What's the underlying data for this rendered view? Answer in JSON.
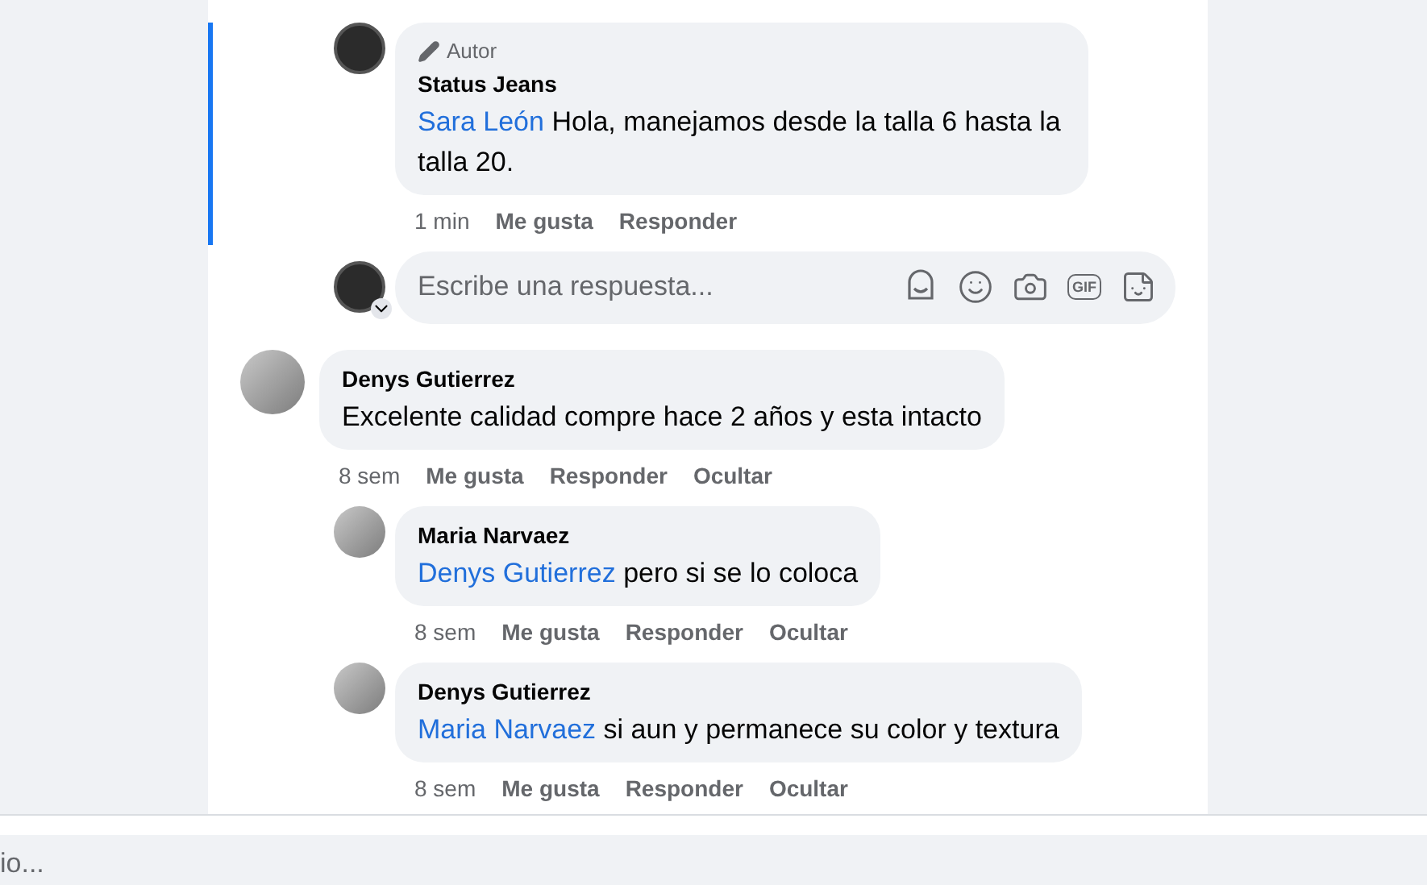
{
  "thread_replies": [
    {
      "badge": "Autor",
      "author": "Status Jeans",
      "mention": "Sara León",
      "text": "Hola, manejamos desde la talla 6 hasta la talla 20.",
      "kind": "logo",
      "time": "1 min",
      "actions": [
        "Me gusta",
        "Responder"
      ]
    }
  ],
  "reply_field": {
    "placeholder": "Escribe una respuesta...",
    "gif_label": "GIF"
  },
  "comments": [
    {
      "author": "Denys Gutierrez",
      "text": "Excelente calidad compre hace 2 años y esta intacto",
      "kind": "photo",
      "time": "8 sem",
      "actions": [
        "Me gusta",
        "Responder",
        "Ocultar"
      ],
      "children": [
        {
          "author": "Maria Narvaez",
          "mention": "Denys Gutierrez",
          "text": "pero si se lo coloca",
          "kind": "photo",
          "time": "8 sem",
          "actions": [
            "Me gusta",
            "Responder",
            "Ocultar"
          ]
        },
        {
          "author": "Denys Gutierrez",
          "mention": "Maria Narvaez",
          "text": "si aun y permanece su color y textura",
          "kind": "photo",
          "time": "8 sem",
          "actions": [
            "Me gusta",
            "Responder",
            "Ocultar"
          ]
        }
      ]
    }
  ],
  "bottom_field": {
    "placeholder": "io..."
  }
}
